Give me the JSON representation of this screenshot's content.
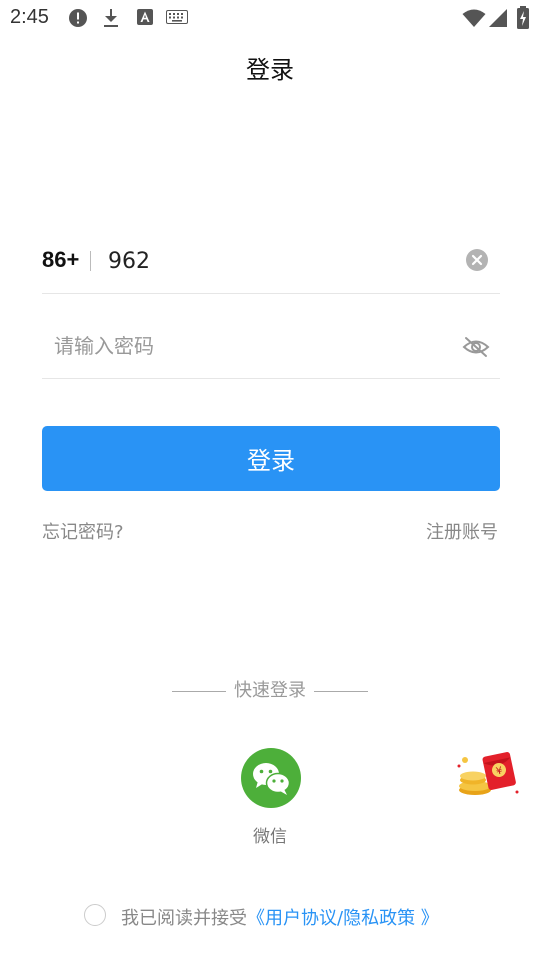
{
  "statusbar": {
    "time": "2:45",
    "icons": [
      "alert-icon",
      "download-icon",
      "font-icon",
      "keyboard-icon",
      "wifi-icon",
      "signal-icon",
      "battery-charging-icon"
    ]
  },
  "header": {
    "title": "登录"
  },
  "phone": {
    "country_code": "86+",
    "value": "962"
  },
  "password": {
    "placeholder": "请输入密码"
  },
  "login_button": {
    "label": "登录"
  },
  "links": {
    "forgot": "忘记密码?",
    "register": "注册账号"
  },
  "quick_login": {
    "label": "快速登录",
    "wechat_label": "微信"
  },
  "agreement": {
    "prefix": "我已阅读并接受",
    "link": "《用户协议/隐私政策 》"
  },
  "colors": {
    "primary": "#2993f5",
    "wechat": "#4daf3a",
    "muted": "#888888"
  }
}
